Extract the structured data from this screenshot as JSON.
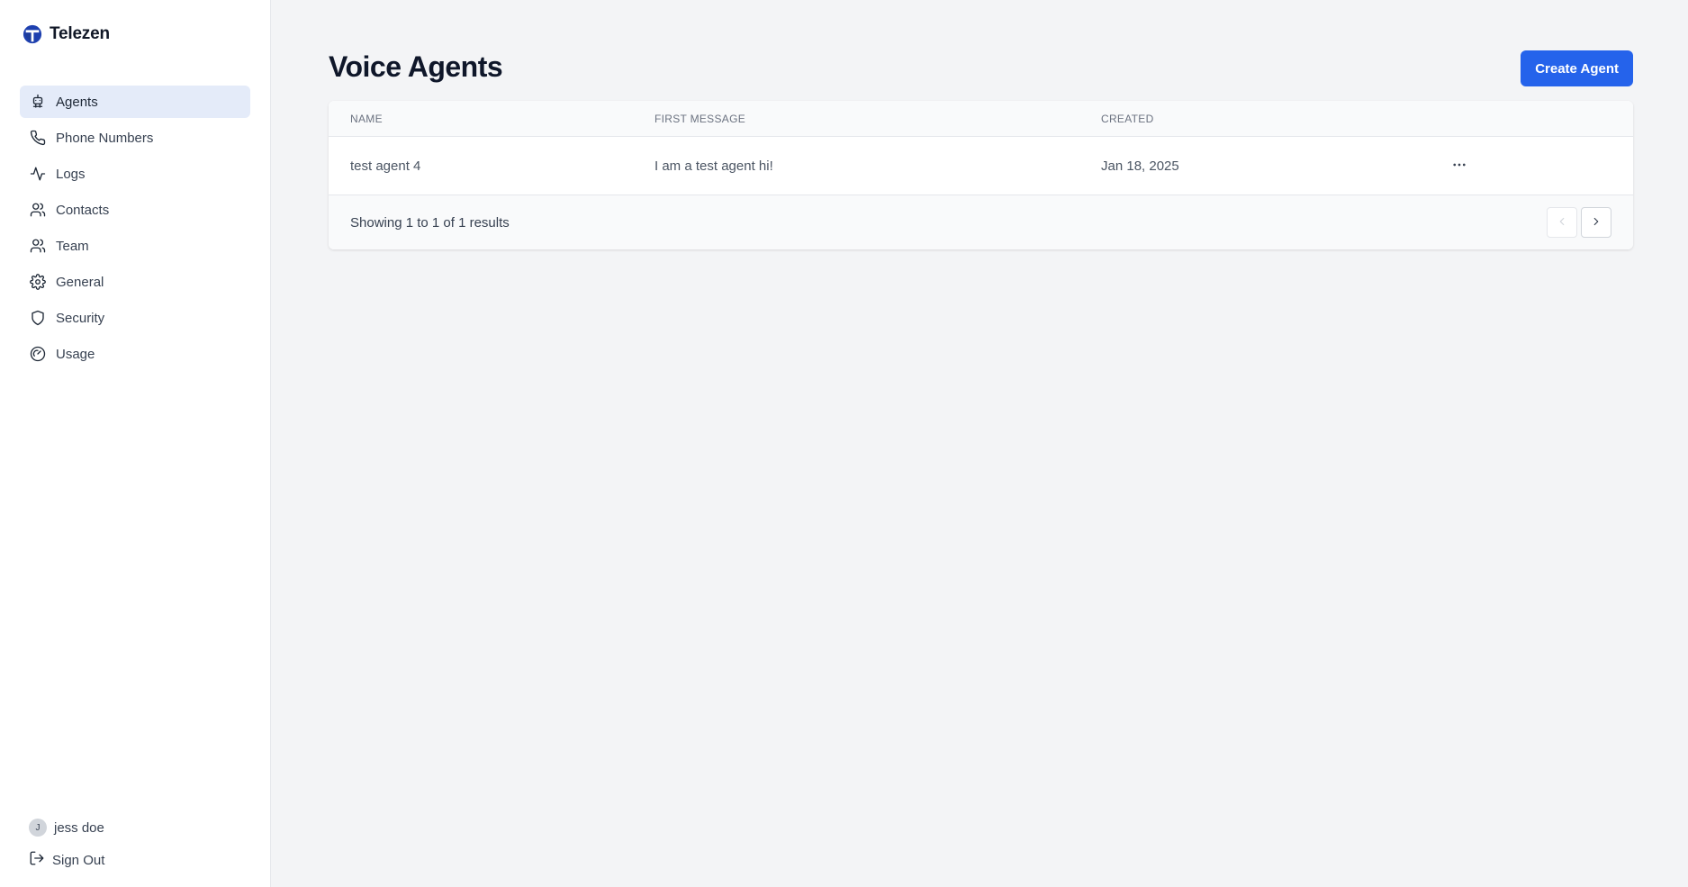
{
  "brand": {
    "name": "Telezen",
    "accent": "#1e40af"
  },
  "sidebar": {
    "items": [
      {
        "label": "Agents",
        "icon": "robot-icon",
        "active": true
      },
      {
        "label": "Phone Numbers",
        "icon": "phone-icon",
        "active": false
      },
      {
        "label": "Logs",
        "icon": "activity-icon",
        "active": false
      },
      {
        "label": "Contacts",
        "icon": "users-icon",
        "active": false
      },
      {
        "label": "Team",
        "icon": "team-icon",
        "active": false
      },
      {
        "label": "General",
        "icon": "gear-icon",
        "active": false
      },
      {
        "label": "Security",
        "icon": "shield-icon",
        "active": false
      },
      {
        "label": "Usage",
        "icon": "gauge-icon",
        "active": false
      }
    ],
    "user": {
      "initial": "J",
      "name": "jess doe"
    },
    "signout_label": "Sign Out"
  },
  "main": {
    "title": "Voice Agents",
    "create_button_label": "Create Agent",
    "create_button_color": "#2563eb",
    "table": {
      "columns": [
        "NAME",
        "FIRST MESSAGE",
        "CREATED"
      ],
      "rows": [
        {
          "name": "test agent 4",
          "first_message": "I am a test agent hi!",
          "created": "Jan 18, 2025"
        }
      ],
      "footer_text": "Showing 1 to 1 of 1 results"
    }
  }
}
